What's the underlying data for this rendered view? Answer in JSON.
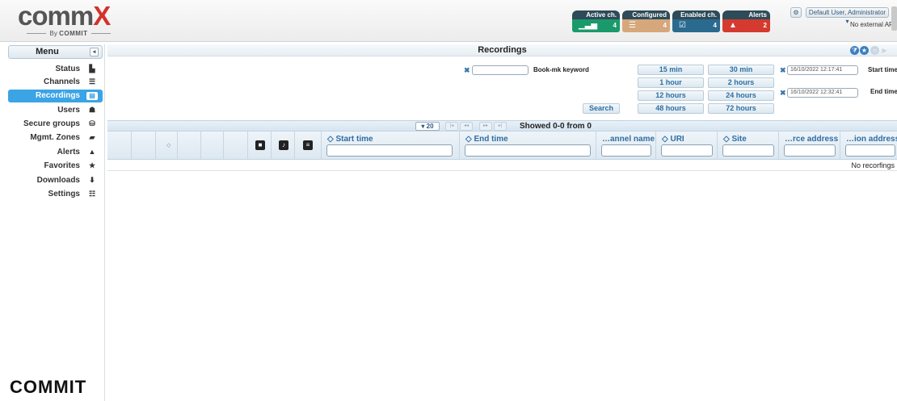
{
  "header": {
    "logo_main": "comm",
    "logo_x": "X",
    "logo_by": "By",
    "logo_brand": "COMMIT",
    "stats": [
      {
        "label": "Active ch.",
        "value": "4",
        "color": "#1a9a6b",
        "icon": "signal-icon"
      },
      {
        "label": "Configured ch.",
        "value": "4",
        "color": "#d6a77b",
        "icon": "list-icon"
      },
      {
        "label": "Enabled ch.",
        "value": "4",
        "color": "#2b6a8f",
        "icon": "checkbox-icon"
      },
      {
        "label": "Alerts",
        "value": "2",
        "color": "#d43a2f",
        "icon": "warning-icon"
      }
    ],
    "user_label": "Default User, Administrator",
    "api_text": "No external API"
  },
  "sidebar": {
    "menu_label": "Menu",
    "items": [
      {
        "label": "Status",
        "icon": "chart-icon",
        "active": false
      },
      {
        "label": "Channels",
        "icon": "list-icon",
        "active": false
      },
      {
        "label": "Recordings",
        "icon": "recordings-icon",
        "active": true
      },
      {
        "label": "Users",
        "icon": "users-icon",
        "active": false
      },
      {
        "label": "Secure groups",
        "icon": "lock-group-icon",
        "active": false
      },
      {
        "label": "Mgmt. Zones",
        "icon": "lock-icon",
        "active": false
      },
      {
        "label": "Alerts",
        "icon": "warning-icon",
        "active": false
      },
      {
        "label": "Favorites",
        "icon": "star-icon",
        "active": false
      },
      {
        "label": "Downloads",
        "icon": "download-icon",
        "active": false
      },
      {
        "label": "Settings",
        "icon": "sliders-icon",
        "active": false
      }
    ],
    "footer_logo": "COMMIT"
  },
  "recordings": {
    "title": "Recordings",
    "keyword_value": "",
    "keyword_label": "Book-mk keyword",
    "search_label": "Search",
    "ranges": [
      "15 min",
      "30 min",
      "1 hour",
      "2 hours",
      "12 hours",
      "24 hours",
      "48 hours",
      "72 hours"
    ],
    "start_time_value": "16/10/2022 12:17:41",
    "start_time_label": "Start time",
    "end_time_value": "16/10/2022 12:32:41",
    "end_time_label": "End time"
  },
  "table": {
    "page_size": "20",
    "page_info": "Showed 0-0 from 0",
    "columns": [
      {
        "title": "Start time"
      },
      {
        "title": "End time"
      },
      {
        "title": "…annel name"
      },
      {
        "title": "URI"
      },
      {
        "title": "Site"
      },
      {
        "title": "…rce address"
      },
      {
        "title": "…ion address"
      }
    ],
    "empty_text": "No recorfings"
  }
}
